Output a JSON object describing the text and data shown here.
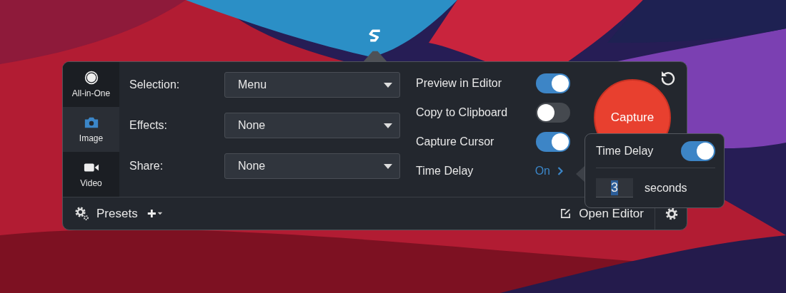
{
  "modes": [
    {
      "label": "All-in-One",
      "kind": "all",
      "selected": false
    },
    {
      "label": "Image",
      "selected": true
    },
    {
      "label": "Video",
      "kind": "video",
      "selected": false
    }
  ],
  "fields": [
    {
      "label": "Selection:",
      "value": "Menu"
    },
    {
      "label": "Effects:",
      "value": "None"
    },
    {
      "label": "Share:",
      "value": "None"
    }
  ],
  "options": [
    {
      "label": "Preview in Editor",
      "kind": "toggle",
      "on": true
    },
    {
      "label": "Copy to Clipboard",
      "kind": "toggle",
      "on": false
    },
    {
      "label": "Capture Cursor",
      "kind": "toggle",
      "on": true
    },
    {
      "label": "Time Delay",
      "kind": "link",
      "value": "On"
    }
  ],
  "capture_button": {
    "label": "Capture"
  },
  "presets": {
    "label": "Presets"
  },
  "open_editor": {
    "label": "Open Editor"
  },
  "popover": {
    "title": "Time Delay",
    "on": true,
    "value": "3",
    "unit": "seconds"
  }
}
